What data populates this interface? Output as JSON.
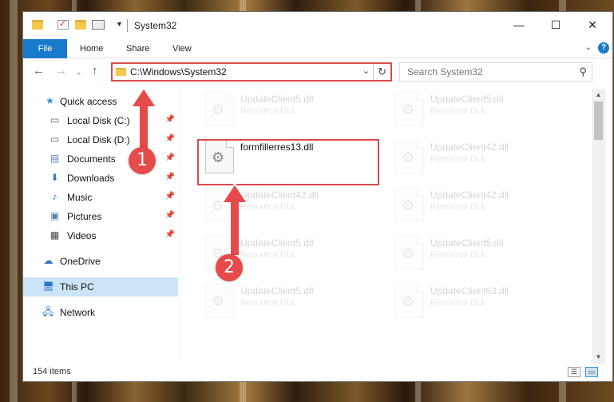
{
  "window": {
    "title": "System32",
    "controls": {
      "minimize": "—",
      "maximize": "☐",
      "close": "✕"
    }
  },
  "ribbon": {
    "tabs": [
      "File",
      "Home",
      "Share",
      "View"
    ],
    "help": "?"
  },
  "address": {
    "path": "C:\\Windows\\System32",
    "search_placeholder": "Search System32"
  },
  "sidebar": {
    "items": [
      {
        "label": "Quick access",
        "icon": "star-icon"
      },
      {
        "label": "Local Disk (C:)",
        "icon": "drive-icon",
        "pinned": true
      },
      {
        "label": "Local Disk (D:)",
        "icon": "drive-icon",
        "pinned": true
      },
      {
        "label": "Documents",
        "icon": "documents-icon",
        "pinned": true
      },
      {
        "label": "Downloads",
        "icon": "download-icon",
        "pinned": true
      },
      {
        "label": "Music",
        "icon": "music-icon",
        "pinned": true
      },
      {
        "label": "Pictures",
        "icon": "pictures-icon",
        "pinned": true
      },
      {
        "label": "Videos",
        "icon": "videos-icon",
        "pinned": true
      },
      {
        "label": "OneDrive",
        "icon": "cloud-icon"
      },
      {
        "label": "This PC",
        "icon": "computer-icon",
        "selected": true
      },
      {
        "label": "Network",
        "icon": "network-icon"
      }
    ]
  },
  "files": {
    "highlighted": {
      "name": "formfillerres13.dll"
    },
    "faded": [
      {
        "name": "UpdateClient5.dll",
        "type": "Resource DLL"
      },
      {
        "name": "UpdateClient5.dll",
        "type": "Resource DLL"
      },
      {
        "name": "UpdateClient42.dll",
        "type": "Resource DLL"
      },
      {
        "name": "UpdateClient42.dll",
        "type": "Resource DLL"
      },
      {
        "name": "UpdateClient42.dll",
        "type": "Resource DLL"
      },
      {
        "name": "UpdateClient5.dll",
        "type": "Resource DLL"
      },
      {
        "name": "UpdateClient5.dll",
        "type": "Resource DLL"
      },
      {
        "name": "UpdateClient5.dll",
        "type": "Resource DLL"
      },
      {
        "name": "UpdateClient63.dll",
        "type": "Resource DLL"
      }
    ]
  },
  "status": {
    "item_count": "154 items"
  },
  "annotations": {
    "step1": "1",
    "step2": "2",
    "color": "#e64a4a"
  }
}
